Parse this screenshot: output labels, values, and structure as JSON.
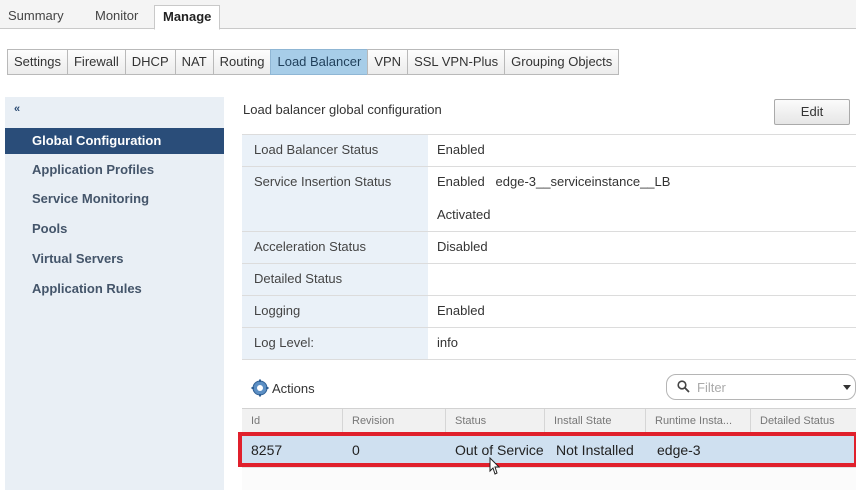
{
  "top_tabs": {
    "summary": "Summary",
    "monitor": "Monitor",
    "manage": "Manage"
  },
  "sub_tabs": [
    "Settings",
    "Firewall",
    "DHCP",
    "NAT",
    "Routing",
    "Load Balancer",
    "VPN",
    "SSL VPN-Plus",
    "Grouping Objects"
  ],
  "sidebar": {
    "collapse": "«",
    "items": [
      "Global Configuration",
      "Application Profiles",
      "Service Monitoring",
      "Pools",
      "Virtual Servers",
      "Application Rules"
    ]
  },
  "panel": {
    "title": "Load balancer global configuration",
    "edit": "Edit",
    "rows": [
      {
        "label": "Load Balancer Status",
        "value": "Enabled"
      },
      {
        "label": "Service Insertion Status",
        "value": "Enabled   edge-3__serviceinstance__LB",
        "value2": "Activated"
      },
      {
        "label": "Acceleration Status",
        "value": "Disabled"
      },
      {
        "label": "Detailed Status",
        "value": ""
      },
      {
        "label": "Logging",
        "value": "Enabled"
      },
      {
        "label": "Log Level:",
        "value": "info"
      }
    ]
  },
  "actions": {
    "label": "Actions"
  },
  "filter": {
    "placeholder": "Filter"
  },
  "grid": {
    "columns": [
      "Id",
      "Revision",
      "Status",
      "Install State",
      "Runtime Insta...",
      "Detailed Status"
    ],
    "rows": [
      [
        "8257",
        "0",
        "Out of Service",
        "Not Installed",
        "edge-3",
        ""
      ]
    ]
  },
  "colors": {
    "accent_selected": "#2a4d79",
    "tab_active": "#a7cde8",
    "highlight": "#e0202c"
  }
}
